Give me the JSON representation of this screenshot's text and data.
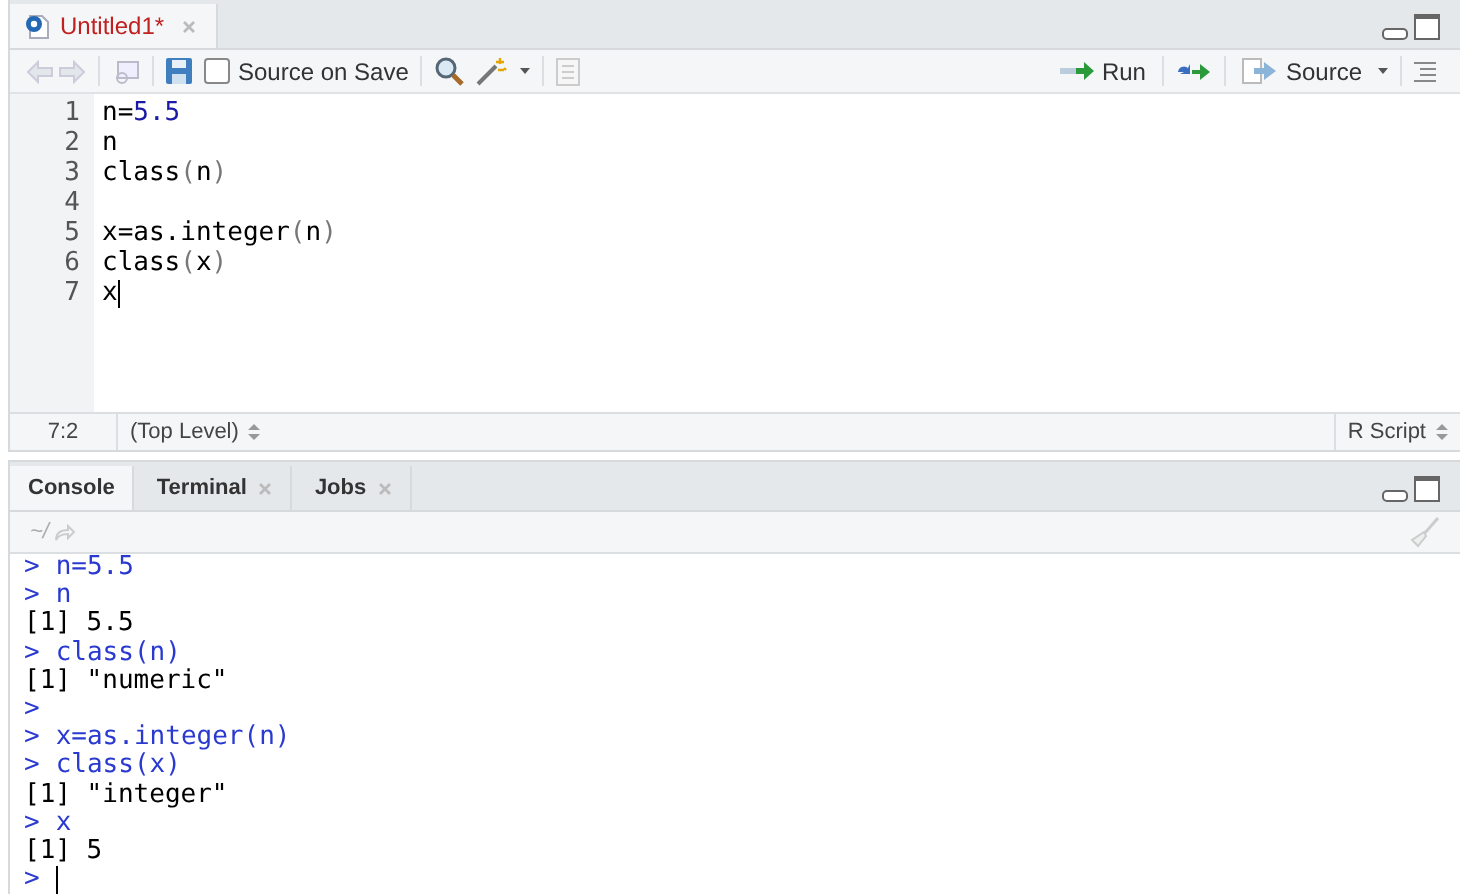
{
  "editor": {
    "tab": {
      "title": "Untitled1*",
      "unsaved": true
    },
    "toolbar": {
      "source_on_save": {
        "label": "Source on Save",
        "checked": false
      },
      "run": "Run",
      "source": "Source"
    },
    "lines": [
      {
        "number": "1",
        "tokens": [
          {
            "text": "n=",
            "kind": "plain"
          },
          {
            "text": "5.5",
            "kind": "number"
          }
        ]
      },
      {
        "number": "2",
        "tokens": [
          {
            "text": "n",
            "kind": "plain"
          }
        ]
      },
      {
        "number": "3",
        "tokens": [
          {
            "text": "class",
            "kind": "plain"
          },
          {
            "text": "(",
            "kind": "paren"
          },
          {
            "text": "n",
            "kind": "plain"
          },
          {
            "text": ")",
            "kind": "paren"
          }
        ]
      },
      {
        "number": "4"
      },
      {
        "number": "5",
        "tokens": [
          {
            "text": "x=as.integer",
            "kind": "plain"
          },
          {
            "text": "(",
            "kind": "paren"
          },
          {
            "text": "n",
            "kind": "plain"
          },
          {
            "text": ")",
            "kind": "paren"
          }
        ]
      },
      {
        "number": "6",
        "tokens": [
          {
            "text": "class",
            "kind": "plain"
          },
          {
            "text": "(",
            "kind": "paren"
          },
          {
            "text": "x",
            "kind": "plain"
          },
          {
            "text": ")",
            "kind": "paren"
          }
        ]
      },
      {
        "number": "7",
        "tokens": [
          {
            "text": "x",
            "kind": "plain"
          }
        ],
        "cursor": true
      }
    ],
    "status": {
      "position": "7:2",
      "scope": "(Top Level)",
      "file_type": "R Script"
    }
  },
  "console": {
    "tabs": [
      {
        "label": "Console",
        "selected": true,
        "closable": false
      },
      {
        "label": "Terminal",
        "selected": false,
        "closable": true
      },
      {
        "label": "Jobs",
        "selected": false,
        "closable": true
      }
    ],
    "path": "~/",
    "lines": [
      {
        "kind": "input",
        "prompt": ">",
        "text": "n=5.5"
      },
      {
        "kind": "input",
        "prompt": ">",
        "text": "n"
      },
      {
        "kind": "output",
        "text": "[1] 5.5"
      },
      {
        "kind": "input",
        "prompt": ">",
        "text": "class(n)"
      },
      {
        "kind": "output",
        "text": "[1] \"numeric\""
      },
      {
        "kind": "input",
        "prompt": ">"
      },
      {
        "kind": "input",
        "prompt": ">",
        "text": "x=as.integer(n)"
      },
      {
        "kind": "input",
        "prompt": ">",
        "text": "class(x)"
      },
      {
        "kind": "output",
        "text": "[1] \"integer\""
      },
      {
        "kind": "input",
        "prompt": ">",
        "text": "x"
      },
      {
        "kind": "output",
        "text": "[1] 5"
      },
      {
        "kind": "input",
        "prompt": ">",
        "cursor": true
      }
    ]
  }
}
